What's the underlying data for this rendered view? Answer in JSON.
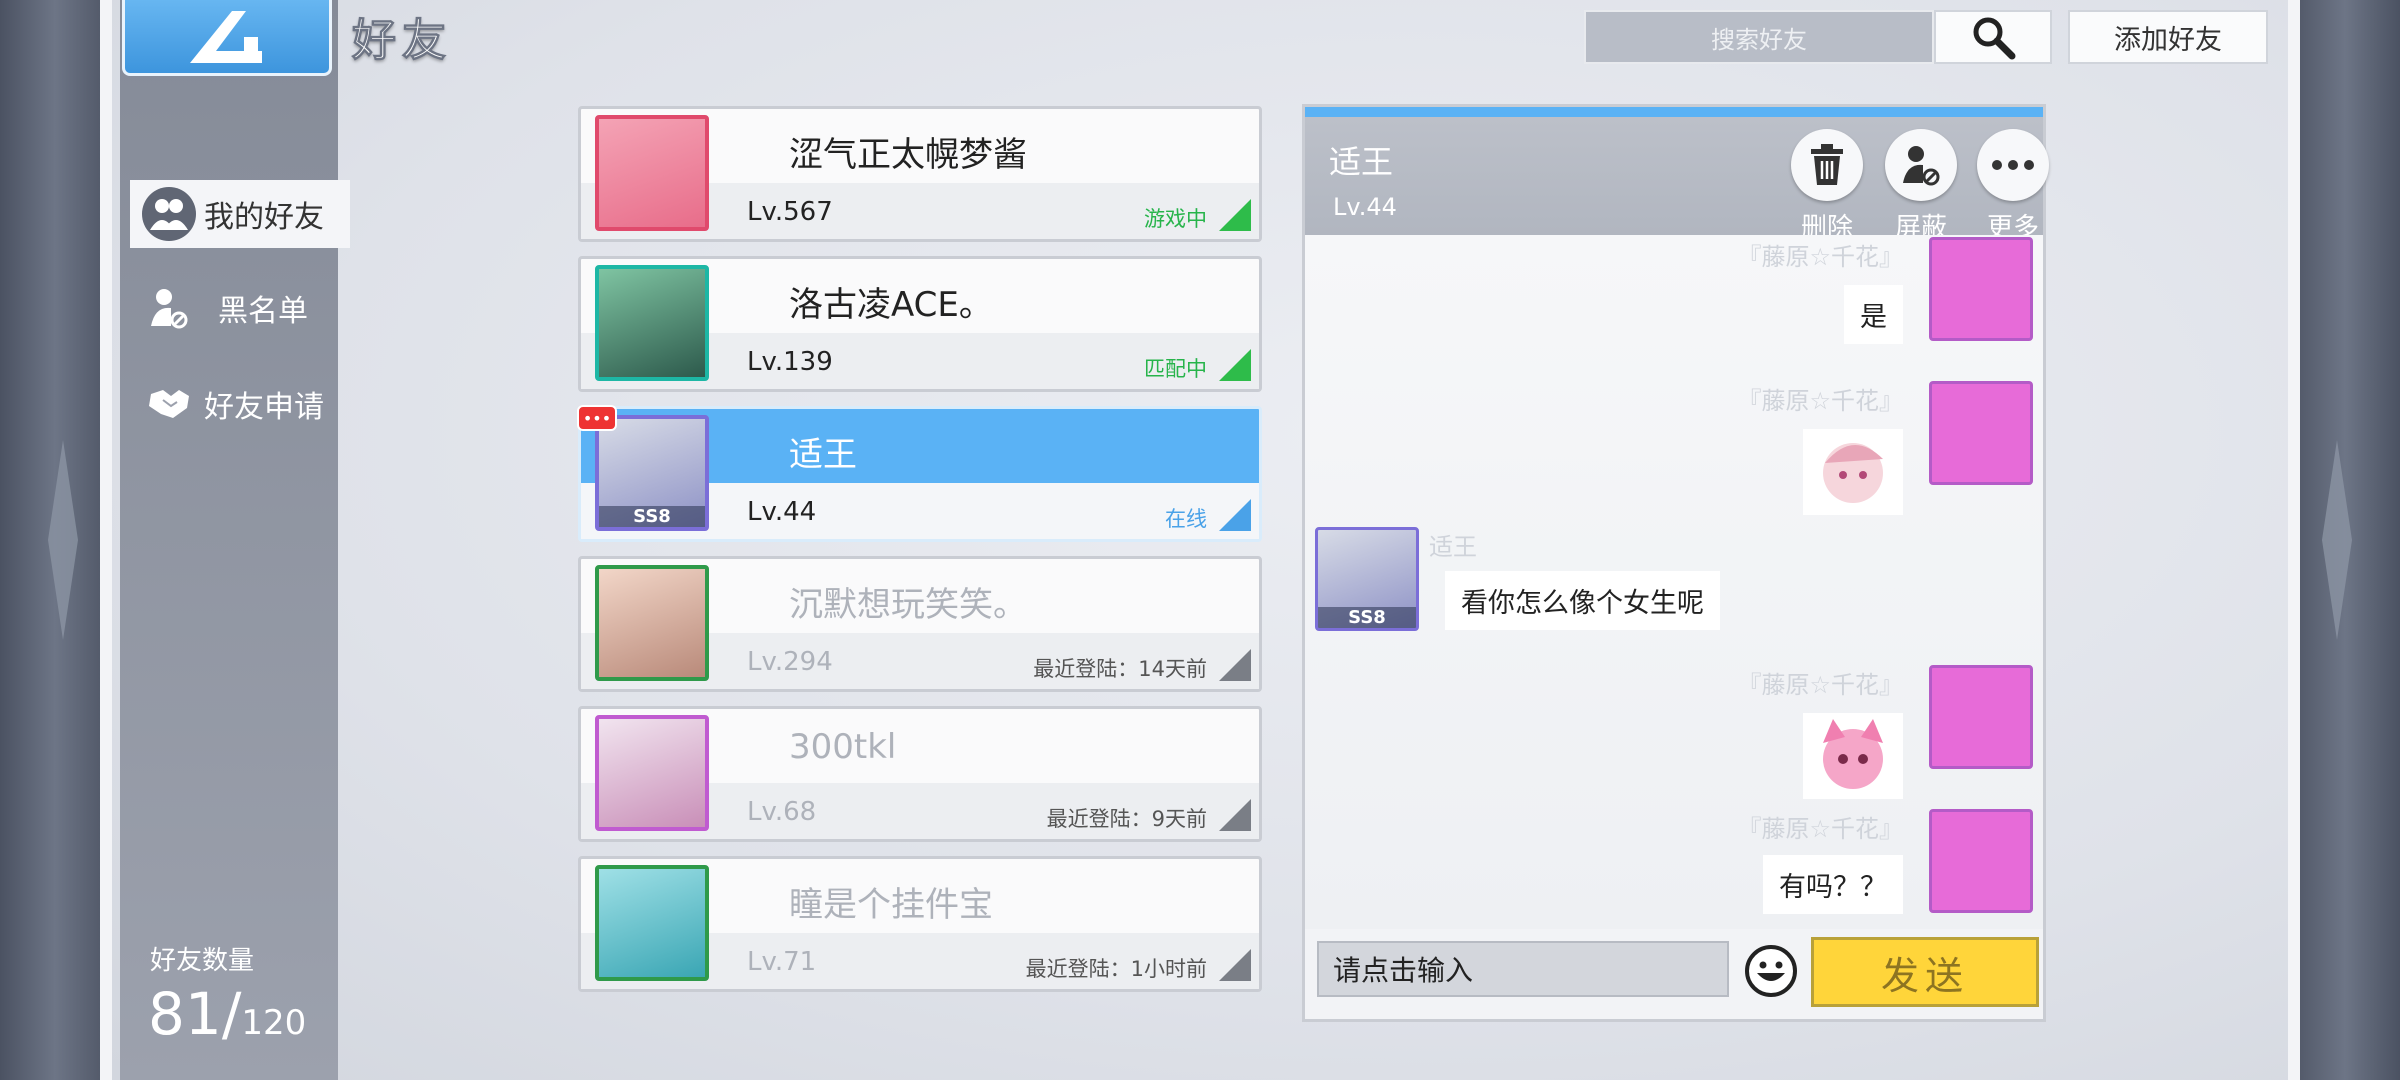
{
  "header": {
    "title": "好友",
    "search_placeholder": "搜索好友",
    "add_friend_label": "添加好友"
  },
  "sidebar": {
    "items": [
      {
        "label": "我的好友",
        "icon": "friends-icon"
      },
      {
        "label": "黑名单",
        "icon": "blacklist-icon"
      },
      {
        "label": "好友申请",
        "icon": "handshake-icon"
      }
    ],
    "friend_count_label": "好友数量",
    "friend_count": "81",
    "friend_max": "120"
  },
  "friends": [
    {
      "name": "涩气正太幌梦酱",
      "level": "Lv.567",
      "status": "游戏中",
      "state": "online"
    },
    {
      "name": "洛古凌ACE。",
      "level": "Lv.139",
      "status": "匹配中",
      "state": "online"
    },
    {
      "name": "适王",
      "level": "Lv.44",
      "status": "在线",
      "state": "selected",
      "badge": "•••",
      "tag": "SS8"
    },
    {
      "name": "沉默想玩笑笑。",
      "level": "Lv.294",
      "status": "最近登陆：14天前",
      "state": "offline"
    },
    {
      "name": "300tkl",
      "level": "Lv.68",
      "status": "最近登陆：9天前",
      "state": "offline"
    },
    {
      "name": "瞳是个挂件宝",
      "level": "Lv.71",
      "status": "最近登陆：1小时前",
      "state": "offline"
    }
  ],
  "chat": {
    "name": "适王",
    "level": "Lv.44",
    "actions": [
      "删除",
      "屏蔽",
      "更多"
    ],
    "messages": [
      {
        "sender": "『藤原☆千花』",
        "text": "是",
        "side": "right"
      },
      {
        "sender": "『藤原☆千花』",
        "text": "",
        "side": "right",
        "sticker": true
      },
      {
        "sender": "适王",
        "text": "看你怎么像个女生呢",
        "side": "left",
        "tag": "SS8"
      },
      {
        "sender": "『藤原☆千花』",
        "text": "",
        "side": "right",
        "sticker": true
      },
      {
        "sender": "『藤原☆千花』",
        "text": "有吗？？",
        "side": "right"
      }
    ],
    "input_placeholder": "请点击输入",
    "send_label": "发送"
  },
  "colors": {
    "accent_blue": "#5ab2f5",
    "online_green": "#2ebc4a",
    "send_yellow": "#ffd53a"
  }
}
